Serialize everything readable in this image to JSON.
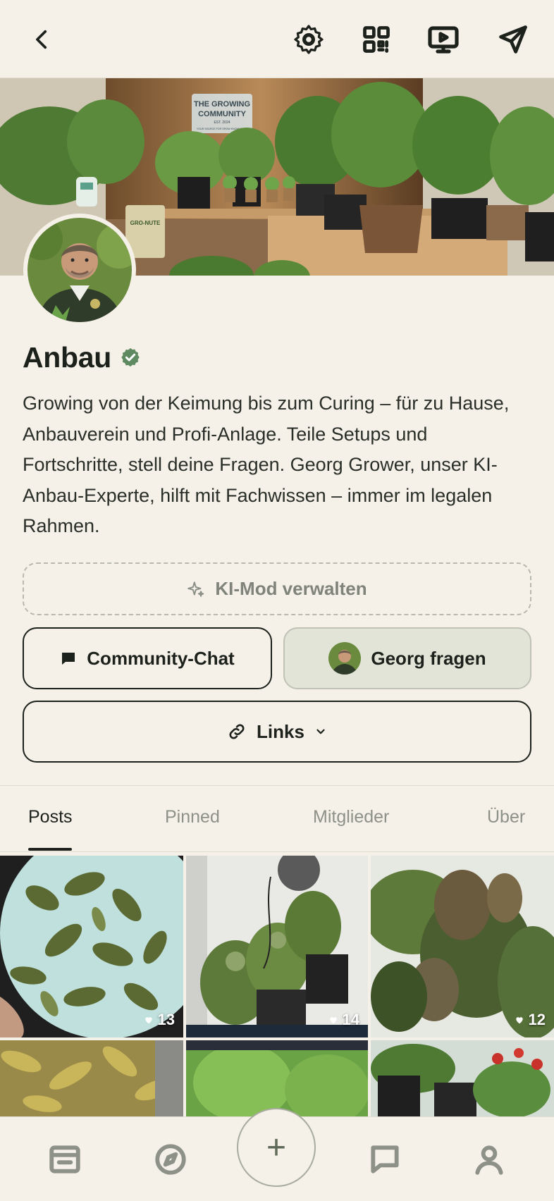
{
  "header": {
    "icons": [
      "back-icon",
      "gear-icon",
      "qr-code-icon",
      "play-screen-icon",
      "send-icon"
    ]
  },
  "cover": {
    "sign_line1": "THE GROWING",
    "sign_line2": "COMMUNITY",
    "sign_line3": "EST. 2024",
    "sign_line4": "YOUR SOURCE FOR GROW KNOWLEDGE",
    "bag_label": "GRO-NUTE"
  },
  "community": {
    "name": "Anbau",
    "verified": true,
    "description": "Growing von der Keimung bis zum Curing – für zu Hause, Anbauverein und Profi-Anlage. Teile Setups und Fortschritte, stell deine Fragen. Georg Grower, unser KI-Anbau-Experte, hilft mit Fachwissen – immer im legalen Rahmen."
  },
  "actions": {
    "kimod_label": "KI-Mod verwalten",
    "chat_label": "Community-Chat",
    "georg_label": "Georg fragen",
    "links_label": "Links"
  },
  "tabs": [
    {
      "label": "Posts",
      "active": true
    },
    {
      "label": "Pinned",
      "active": false
    },
    {
      "label": "Mitglieder",
      "active": false
    },
    {
      "label": "Über",
      "active": false
    }
  ],
  "posts": [
    {
      "likes": "13"
    },
    {
      "likes": "14"
    },
    {
      "likes": "12"
    }
  ],
  "nav": {
    "fab_label": "+",
    "icons": [
      "feed-icon",
      "compass-icon",
      "add-icon",
      "chat-icon",
      "profile-icon"
    ]
  },
  "colors": {
    "background": "#f5f1e8",
    "verified": "#5f8a61",
    "text": "#1d211c",
    "muted": "#8d9187"
  }
}
